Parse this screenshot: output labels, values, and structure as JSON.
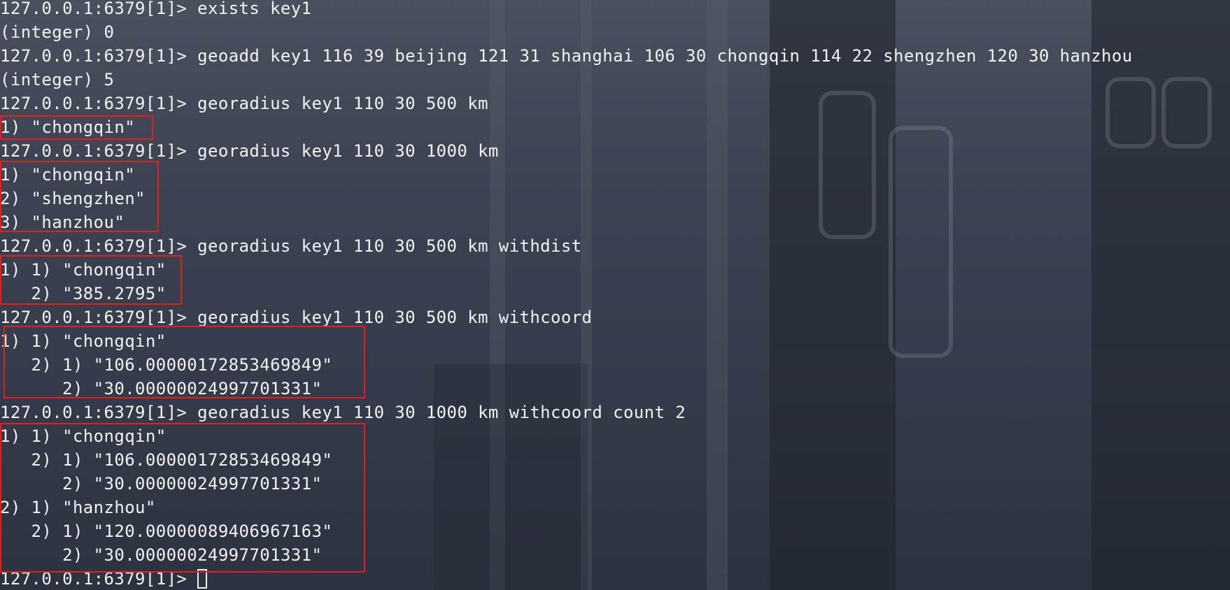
{
  "terminal": {
    "prompt": "127.0.0.1:6379[1]> ",
    "lines": [
      {
        "kind": "cmd",
        "text": "exists key1"
      },
      {
        "kind": "out",
        "text": "(integer) 0"
      },
      {
        "kind": "cmd",
        "text": "geoadd key1 116 39 beijing 121 31 shanghai 106 30 chongqin 114 22 shengzhen 120 30 hanzhou"
      },
      {
        "kind": "out",
        "text": "(integer) 5"
      },
      {
        "kind": "cmd",
        "text": "georadius key1 110 30 500 km"
      },
      {
        "kind": "out",
        "text": "1) \"chongqin\""
      },
      {
        "kind": "cmd",
        "text": "georadius key1 110 30 1000 km"
      },
      {
        "kind": "out",
        "text": "1) \"chongqin\""
      },
      {
        "kind": "out",
        "text": "2) \"shengzhen\""
      },
      {
        "kind": "out",
        "text": "3) \"hanzhou\""
      },
      {
        "kind": "cmd",
        "text": "georadius key1 110 30 500 km withdist"
      },
      {
        "kind": "out",
        "text": "1) 1) \"chongqin\""
      },
      {
        "kind": "out",
        "text": "   2) \"385.2795\""
      },
      {
        "kind": "cmd",
        "text": "georadius key1 110 30 500 km withcoord"
      },
      {
        "kind": "out",
        "text": "1) 1) \"chongqin\""
      },
      {
        "kind": "out",
        "text": "   2) 1) \"106.00000172853469849\""
      },
      {
        "kind": "out",
        "text": "      2) \"30.00000024997701331\""
      },
      {
        "kind": "cmd",
        "text": "georadius key1 110 30 1000 km withcoord count 2"
      },
      {
        "kind": "out",
        "text": "1) 1) \"chongqin\""
      },
      {
        "kind": "out",
        "text": "   2) 1) \"106.00000172853469849\""
      },
      {
        "kind": "out",
        "text": "      2) \"30.00000024997701331\""
      },
      {
        "kind": "out",
        "text": "2) 1) \"hanzhou\""
      },
      {
        "kind": "out",
        "text": "   2) 1) \"120.00000089406967163\""
      },
      {
        "kind": "out",
        "text": "      2) \"30.00000024997701331\""
      },
      {
        "kind": "cmd",
        "text": ""
      }
    ]
  },
  "colors": {
    "text": "#f2f2f2",
    "highlight_border": "#e0201c"
  }
}
